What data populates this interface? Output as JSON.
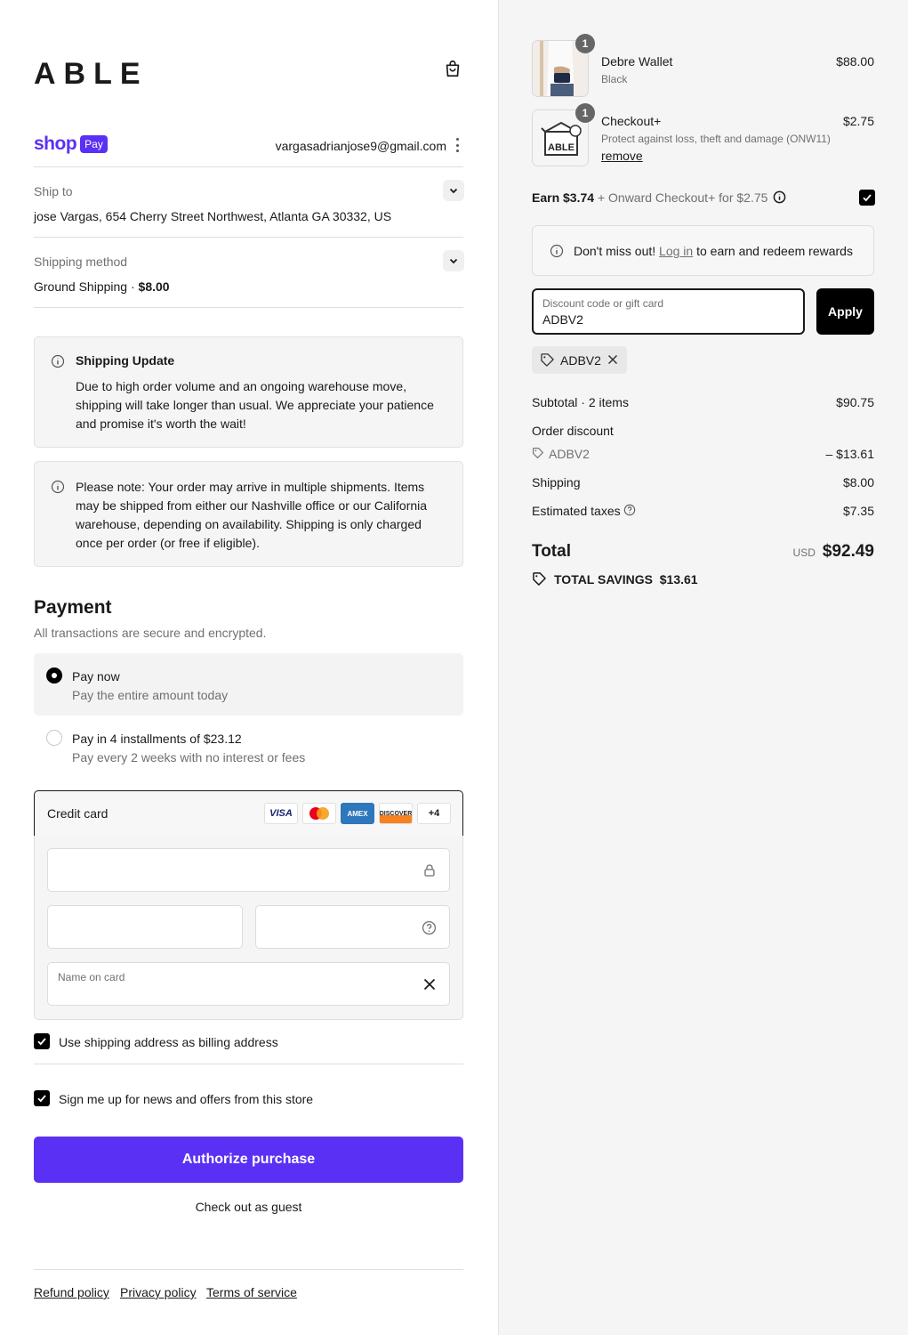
{
  "brand": {
    "logo": "ABLE"
  },
  "shop_pay": {
    "shop": "shop",
    "pay": "Pay",
    "email": "vargasadrianjose9@gmail.com"
  },
  "ship_to": {
    "label": "Ship to",
    "value": "jose Vargas, 654 Cherry Street Northwest, Atlanta GA 30332, US"
  },
  "shipping_method": {
    "label": "Shipping method",
    "name": "Ground Shipping · ",
    "price": "$8.00"
  },
  "notices": {
    "update_title": "Shipping Update",
    "update_text": "Due to high order volume and an ongoing warehouse move, shipping will take longer than usual. We appreciate your patience and promise it's worth the wait!",
    "note_text": "Please note: Your order may arrive in multiple shipments. Items may be shipped from either our Nashville office or our California warehouse, depending on availability. Shipping is only charged once per order (or free if eligible)."
  },
  "payment": {
    "title": "Payment",
    "subtitle": "All transactions are secure and encrypted.",
    "options": [
      {
        "title": "Pay now",
        "desc": "Pay the entire amount today"
      },
      {
        "title": "Pay in 4 installments of $23.12",
        "desc": "Pay every 2 weeks with no interest or fees"
      }
    ],
    "credit_card_label": "Credit card",
    "card_brands": [
      "VISA",
      "MC",
      "AMEX",
      "DISCOVER"
    ],
    "more_cards": "+4",
    "name_on_card_label": "Name on card"
  },
  "billing_checkbox": "Use shipping address as billing address",
  "news_checkbox": "Sign me up for news and offers from this store",
  "authorize_button": "Authorize purchase",
  "guest_link": "Check out as guest",
  "footer": {
    "refund": "Refund policy",
    "privacy": "Privacy policy",
    "terms": "Terms of service"
  },
  "cart": {
    "items": [
      {
        "qty": "1",
        "name": "Debre Wallet",
        "variant": "Black",
        "price": "$88.00"
      },
      {
        "qty": "1",
        "name": "Checkout+",
        "variant": "Protect against loss, theft and damage (ONW11)",
        "remove": "remove",
        "price": "$2.75"
      }
    ],
    "earn": {
      "bold": "Earn $3.74",
      "rest": "+ Onward Checkout+ for $2.75"
    },
    "rewards": {
      "pre": "Don't miss out!",
      "link": "Log in",
      "post": "to earn and redeem rewards"
    },
    "discount": {
      "label": "Discount code or gift card",
      "value": "ADBV2",
      "apply": "Apply",
      "chip": "ADBV2"
    },
    "summary": {
      "subtotal_label": "Subtotal · 2 items",
      "subtotal": "$90.75",
      "order_discount_label": "Order discount",
      "discount_code": "ADBV2",
      "discount_value": "– $13.61",
      "shipping_label": "Shipping",
      "shipping": "$8.00",
      "taxes_label": "Estimated taxes",
      "taxes": "$7.35",
      "total_label": "Total",
      "currency": "USD",
      "total": "$92.49",
      "savings_label": "TOTAL SAVINGS",
      "savings": "$13.61"
    }
  },
  "colors": {
    "accent": "#5a31f4",
    "sidebar_bg": "#f5f5f5"
  }
}
